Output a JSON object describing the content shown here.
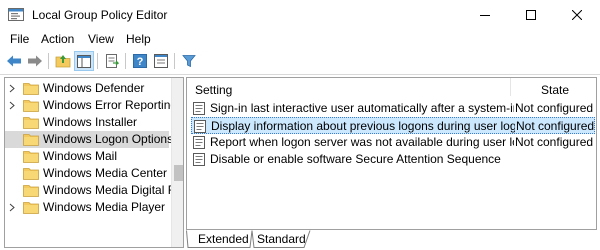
{
  "window": {
    "title": "Local Group Policy Editor"
  },
  "menu": {
    "items": [
      "File",
      "Action",
      "View",
      "Help"
    ]
  },
  "toolbar": {
    "buttons": [
      "back-arrow-icon",
      "forward-arrow-icon",
      "up-folder-icon",
      "show-hide-tree-icon",
      "export-list-icon",
      "help-icon",
      "properties-icon",
      "filter-icon"
    ]
  },
  "tree": {
    "items": [
      {
        "label": "Windows Defender",
        "expandable": true,
        "selected": false
      },
      {
        "label": "Windows Error Reporting",
        "expandable": true,
        "selected": false
      },
      {
        "label": "Windows Installer",
        "expandable": false,
        "selected": false
      },
      {
        "label": "Windows Logon Options",
        "expandable": false,
        "selected": true
      },
      {
        "label": "Windows Mail",
        "expandable": false,
        "selected": false
      },
      {
        "label": "Windows Media Center",
        "expandable": false,
        "selected": false
      },
      {
        "label": "Windows Media Digital Rig",
        "expandable": false,
        "selected": false
      },
      {
        "label": "Windows Media Player",
        "expandable": true,
        "selected": false
      }
    ]
  },
  "policies": {
    "headers": {
      "setting": "Setting",
      "state": "State"
    },
    "rows": [
      {
        "name": "Sign-in last interactive user automatically after a system-init...",
        "state": "Not configured",
        "selected": false
      },
      {
        "name": "Display information about previous logons during user logon",
        "state": "Not configured",
        "selected": true
      },
      {
        "name": "Report when logon server was not available during user logon",
        "state": "Not configured",
        "selected": false
      },
      {
        "name": "Disable or enable software Secure Attention Sequence",
        "state": "",
        "selected": false
      }
    ]
  },
  "tabs": {
    "extended": "Extended",
    "standard": "Standard"
  },
  "colors": {
    "selection_highlight": "#cce8ff",
    "tree_selection": "#d9d9d9",
    "folder": "#f4c95d",
    "arrow_blue": "#3e86c8"
  }
}
